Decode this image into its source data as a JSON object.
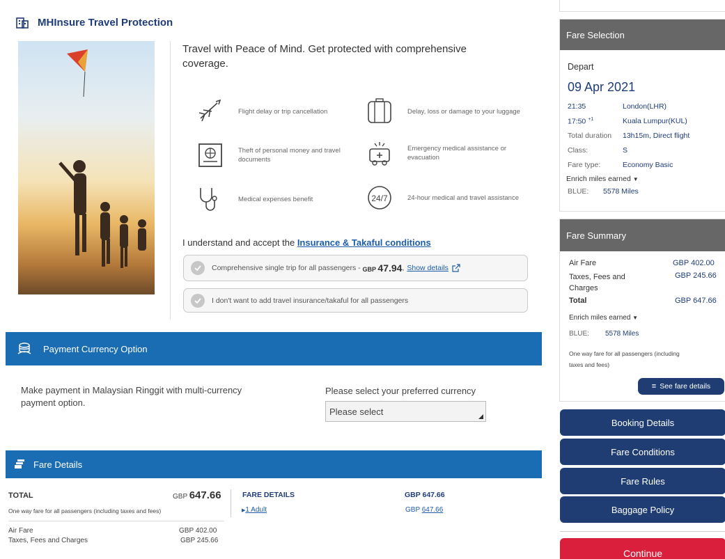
{
  "insurance": {
    "title": "MHInsure Travel Protection",
    "headline": "Travel with Peace of Mind. Get protected with comprehensive coverage.",
    "benefits": [
      {
        "icon": "airplane-icon",
        "text": "Flight delay or trip cancellation"
      },
      {
        "icon": "luggage-icon",
        "text": "Delay, loss or damage to your luggage"
      },
      {
        "icon": "passport-icon",
        "text": "Theft of personal money and travel documents"
      },
      {
        "icon": "ambulance-icon",
        "text": "Emergency medical assistance or evacuation"
      },
      {
        "icon": "stethoscope-icon",
        "text": "Medical expenses benefit"
      },
      {
        "icon": "24-7-icon",
        "text": "24-hour medical and travel assistance"
      }
    ],
    "accept_text": "I understand and accept the",
    "accept_link": "Insurance & Takaful conditions",
    "option1": {
      "label": "Comprehensive single trip",
      "scope": "for all passengers -",
      "currency": "GBP",
      "price": "47.94",
      "comma": ",",
      "link": "Show details"
    },
    "option2": {
      "label": "I don't want to add travel insurance/takaful",
      "scope": "for all passengers"
    }
  },
  "currency": {
    "band_title": "Payment Currency Option",
    "description": "Make payment in Malaysian Ringgit with multi-currency payment option.",
    "select_label": "Please select your preferred currency",
    "select_value": "Please select"
  },
  "fare_details": {
    "band_title": "Fare Details",
    "total_label": "TOTAL",
    "total_currency": "GBP",
    "total_value": "647.66",
    "note": "One way fare for all passengers (including taxes and fees)",
    "air_fare_label": "Air Fare",
    "air_fare_value": "GBP 402.00",
    "taxes_label": "Taxes, Fees and Charges",
    "taxes_value": "GBP 245.66",
    "col_header": "FARE DETAILS",
    "col_amount": "GBP 647.66",
    "adult_link": "1 Adult",
    "adult_currency": "GBP",
    "adult_amount": "647.66"
  },
  "fare_selection": {
    "header": "Fare Selection",
    "depart_label": "Depart",
    "date": "09 Apr 2021",
    "dep_time": "21:35",
    "dep_city": "London(LHR)",
    "arr_time": "17:50",
    "arr_plus": "+1",
    "arr_city": "Kuala Lumpur(KUL)",
    "duration_label": "Total duration",
    "duration_value": "13h15m, Direct flight",
    "class_label": "Class:",
    "class_value": "S",
    "faretype_label": "Fare type:",
    "faretype_value": "Economy Basic",
    "miles_label": "Enrich miles earned",
    "tier": "BLUE:",
    "miles": "5578 Miles"
  },
  "fare_summary": {
    "header": "Fare Summary",
    "air_fare_label": "Air Fare",
    "air_fare_value": "GBP 402.00",
    "taxes_label": "Taxes, Fees and Charges",
    "taxes_value": "GBP 245.66",
    "total_label": "Total",
    "total_value": "GBP 647.66",
    "miles_label": "Enrich miles earned",
    "tier": "BLUE:",
    "miles": "5578 Miles",
    "note": "One way fare for all passengers (including taxes and fees)",
    "see_details": "See fare details"
  },
  "nav": {
    "booking_details": "Booking Details",
    "fare_conditions": "Fare Conditions",
    "fare_rules": "Fare Rules",
    "baggage_policy": "Baggage Policy",
    "continue": "Continue"
  },
  "colors": {
    "brand_blue": "#1a6cb3",
    "navy": "#1f3d73",
    "continue_red": "#d91f3c",
    "panel_grey": "#676767"
  }
}
